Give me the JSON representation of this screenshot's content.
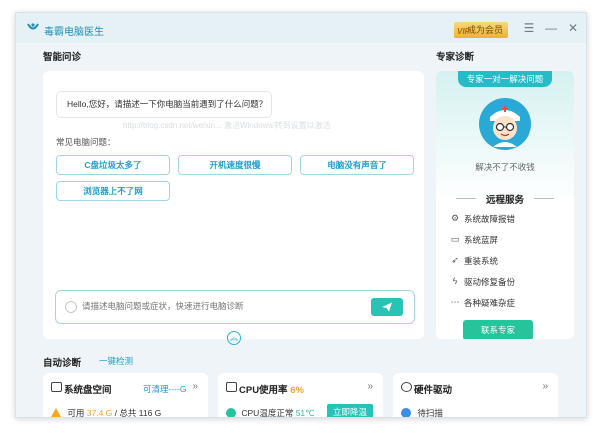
{
  "app": {
    "title": "毒霸电脑医生",
    "vip_label": "成为会员",
    "vip_crown": "VIP"
  },
  "window_controls": {
    "menu_icon": "menu-icon",
    "minimize_icon": "minimize-icon",
    "close_icon": "close-icon"
  },
  "smart_diagnosis": {
    "title": "智能问诊",
    "greeting": "Hello,您好，请描述一下你电脑当前遇到了什么问题？",
    "watermark": "http://blog.csdn.net/weixin... 激活Windows/转到设置以激活",
    "common_label": "常见电脑问题：",
    "chips": [
      "C盘垃圾太多了",
      "开机速度很慢",
      "电脑没有声音了",
      "浏览器上不了网"
    ],
    "input_placeholder": "请描述电脑问题或症状，快速进行电脑诊断"
  },
  "expert": {
    "title": "专家诊断",
    "pill": "专家一对一解决问题",
    "caption": "解决不了不收钱",
    "remote_title": "远程服务",
    "services": [
      {
        "icon": "fault-report-icon",
        "label": "系统故障报错"
      },
      {
        "icon": "blue-screen-icon",
        "label": "系统蓝屏"
      },
      {
        "icon": "reinstall-icon",
        "label": "重装系统"
      },
      {
        "icon": "driver-icon",
        "label": "驱动修复备份"
      },
      {
        "icon": "more-icon",
        "label": "各种疑难杂症"
      }
    ],
    "contact_label": "联系专家"
  },
  "auto_diagnosis": {
    "title": "自动诊断",
    "one_click": "一键检测",
    "cards": [
      {
        "title": "系统盘空间",
        "extra": "可清理----G",
        "line_prefix": "可用",
        "used": "37.4 G",
        "line_suffix": "/ 总共 116 G"
      },
      {
        "title_prefix": "CPU使用率",
        "percent": "6%",
        "status": "CPU温度正常",
        "temp": "51℃",
        "button": "立即降温"
      },
      {
        "title": "硬件驱动",
        "status": "待扫描"
      }
    ]
  },
  "colors": {
    "accent": "#1f9fcd",
    "teal": "#25bcc8",
    "green": "#25c49a",
    "warning": "#f5a623"
  }
}
